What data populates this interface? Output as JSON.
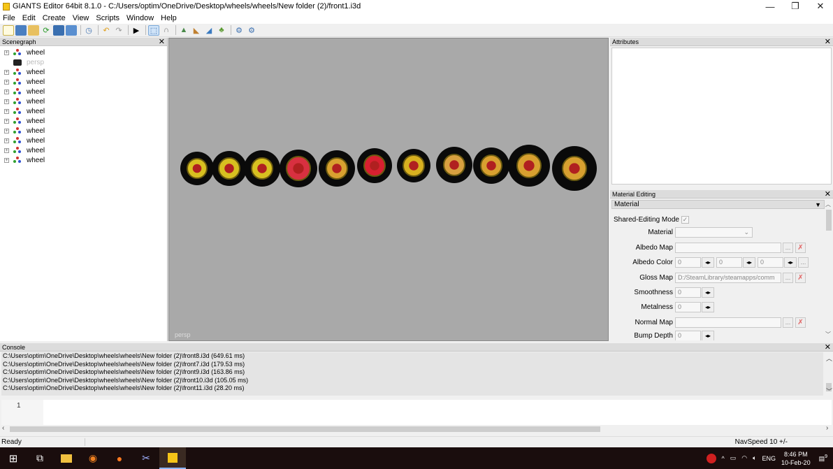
{
  "window": {
    "title": "GIANTS Editor 64bit 8.1.0 - C:/Users/optim/OneDrive/Desktop/wheels/wheels/New folder (2)/front1.i3d",
    "minimize": "—",
    "maximize": "❐",
    "close": "✕"
  },
  "menu": [
    "File",
    "Edit",
    "Create",
    "View",
    "Scripts",
    "Window",
    "Help"
  ],
  "scenegraph": {
    "title": "Scenegraph",
    "close": "✕",
    "items": [
      {
        "label": "wheel",
        "kind": "transform"
      },
      {
        "label": "persp",
        "kind": "camera"
      },
      {
        "label": "wheel",
        "kind": "transform"
      },
      {
        "label": "wheel",
        "kind": "transform"
      },
      {
        "label": "wheel",
        "kind": "transform"
      },
      {
        "label": "wheel",
        "kind": "transform"
      },
      {
        "label": "wheel",
        "kind": "transform"
      },
      {
        "label": "wheel",
        "kind": "transform"
      },
      {
        "label": "wheel",
        "kind": "transform"
      },
      {
        "label": "wheel",
        "kind": "transform"
      },
      {
        "label": "wheel",
        "kind": "transform"
      },
      {
        "label": "wheel",
        "kind": "transform"
      }
    ]
  },
  "viewport": {
    "camera_label": "persp"
  },
  "attributes": {
    "title": "Attributes",
    "close": "✕"
  },
  "material_editing": {
    "title": "Material Editing",
    "close": "✕",
    "section": "Material",
    "shared_editing_label": "Shared-Editing Mode",
    "check": "✓",
    "material_label": "Material",
    "albedo_map_label": "Albedo Map",
    "albedo_color_label": "Albedo Color",
    "albedo_r": "0",
    "albedo_g": "0",
    "albedo_b": "0",
    "gloss_map_label": "Gloss Map",
    "gloss_map_value": "D:/SteamLibrary/steamapps/comm",
    "smoothness_label": "Smoothness",
    "smoothness_value": "0",
    "metalness_label": "Metalness",
    "metalness_value": "0",
    "normal_map_label": "Normal Map",
    "bump_depth_label": "Bump Depth",
    "bump_depth_value": "0"
  },
  "console": {
    "title": "Console",
    "close": "✕",
    "lines": [
      "C:\\Users\\optim\\OneDrive\\Desktop\\wheels\\wheels\\New folder (2)\\front8.i3d (649.61 ms)",
      "C:\\Users\\optim\\OneDrive\\Desktop\\wheels\\wheels\\New folder (2)\\front7.i3d (179.53 ms)",
      "C:\\Users\\optim\\OneDrive\\Desktop\\wheels\\wheels\\New folder (2)\\front9.i3d (163.86 ms)",
      "C:\\Users\\optim\\OneDrive\\Desktop\\wheels\\wheels\\New folder (2)\\front10.i3d (105.05 ms)",
      "C:\\Users\\optim\\OneDrive\\Desktop\\wheels\\wheels\\New folder (2)\\front11.i3d (28.20 ms)"
    ],
    "line_number": "1"
  },
  "status": {
    "ready": "Ready",
    "navspeed": "NavSpeed 10 +/-"
  },
  "taskbar": {
    "lang": "ENG",
    "time": "8:46 PM",
    "date": "10-Feb-20",
    "notif": "9"
  }
}
